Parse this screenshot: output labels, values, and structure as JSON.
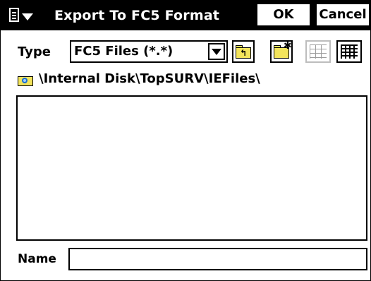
{
  "window": {
    "title": "Export To FC5 Format",
    "ok_label": "OK",
    "cancel_label": "Cancel"
  },
  "type_row": {
    "label": "Type",
    "selected": "FC5 Files (*.*)"
  },
  "toolbar": {
    "icons": [
      "folder-up-icon",
      "new-folder-icon",
      "list-view-icon",
      "details-view-icon"
    ]
  },
  "path": {
    "icon": "folder-search-icon",
    "text": "\\Internal Disk\\TopSURV\\IEFiles\\"
  },
  "file_list": {
    "items": []
  },
  "name_row": {
    "label": "Name",
    "value": "",
    "placeholder": ""
  },
  "colors": {
    "titlebar": "#000000",
    "folder": "#f3e45c"
  }
}
